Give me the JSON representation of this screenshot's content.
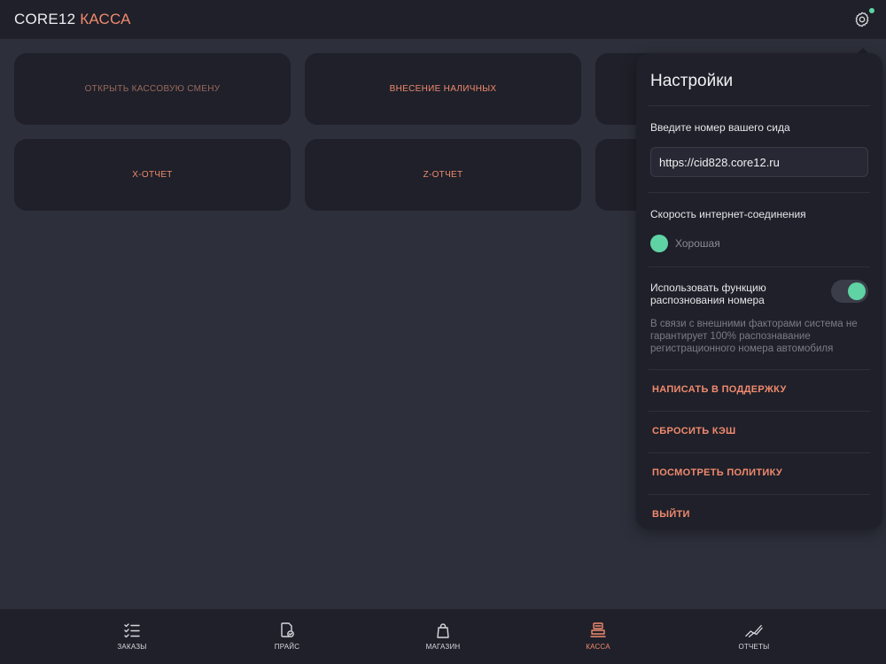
{
  "header": {
    "brand_primary": "CORE12",
    "brand_secondary": "КАССА",
    "settings_icon": "gear-icon"
  },
  "tiles": [
    {
      "label": "ОТКРЫТЬ КАССОВУЮ СМЕНУ",
      "style": "muted"
    },
    {
      "label": "ВНЕСЕНИЕ НАЛИЧНЫХ",
      "style": "accent"
    },
    {
      "label": "X-ОТЧЕТ",
      "style": "accent"
    },
    {
      "label": "Z-ОТЧЕТ",
      "style": "accent"
    }
  ],
  "settings": {
    "title": "Настройки",
    "sid_label": "Введите номер вашего сида",
    "sid_value": "https://cid828.core12.ru",
    "speed_label": "Скорость интернет-соединения",
    "speed_status": "Хорошая",
    "recognition_label": "Использовать функцию распознования номера",
    "recognition_enabled": true,
    "recognition_note": "В связи с внешними факторами система не гарантирует 100% распознавание регистрационного номера автомобиля",
    "actions": {
      "support": "НАПИСАТЬ В ПОДДЕРЖКУ",
      "reset_cache": "СБРОСИТЬ КЭШ",
      "policy": "ПОСМОТРЕТЬ ПОЛИТИКУ",
      "logout": "ВЫЙТИ"
    }
  },
  "nav": {
    "active": "kassa",
    "items": [
      {
        "id": "orders",
        "label": "ЗАКАЗЫ",
        "icon": "checklist-icon"
      },
      {
        "id": "price",
        "label": "ПРАЙС",
        "icon": "price-doc-icon"
      },
      {
        "id": "shop",
        "label": "МАГАЗИН",
        "icon": "shopping-bag-icon"
      },
      {
        "id": "kassa",
        "label": "КАССА",
        "icon": "cash-register-icon"
      },
      {
        "id": "reports",
        "label": "ОТЧЕТЫ",
        "icon": "chart-trend-icon"
      }
    ]
  },
  "colors": {
    "accent": "#f08a6e",
    "success": "#5fd3a4",
    "surface": "#1f2029",
    "background": "#2d2f3a"
  }
}
